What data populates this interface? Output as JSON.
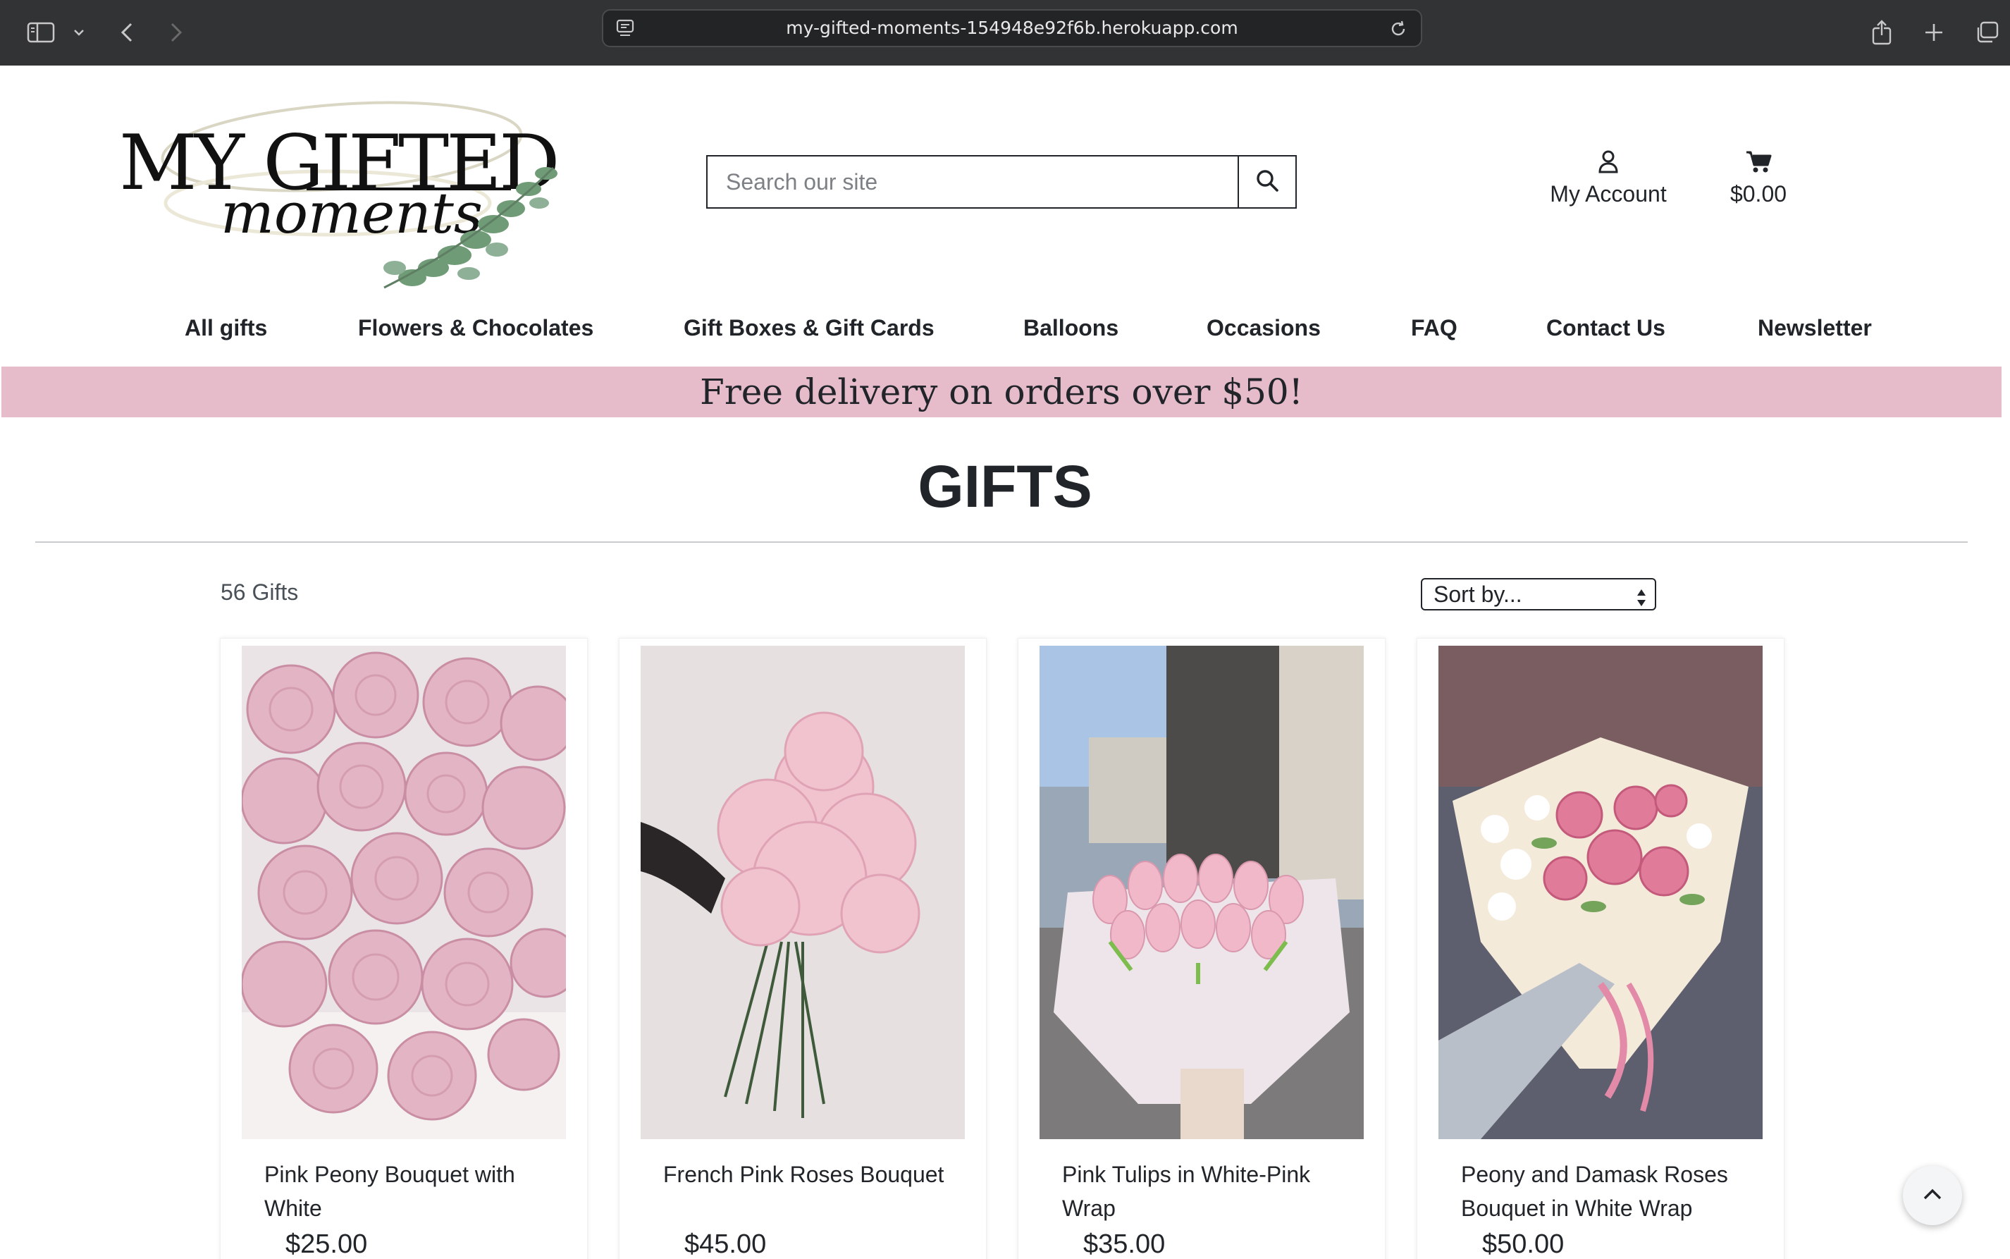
{
  "browser": {
    "url": "my-gifted-moments-154948e92f6b.herokuapp.com"
  },
  "header": {
    "logo_text": "MY GIFTED moments",
    "search_placeholder": "Search our site",
    "account_label": "My Account",
    "cart_total": "$0.00"
  },
  "nav": {
    "items": [
      {
        "label": "All gifts"
      },
      {
        "label": "Flowers & Chocolates"
      },
      {
        "label": "Gift Boxes & Gift Cards"
      },
      {
        "label": "Balloons"
      },
      {
        "label": "Occasions"
      },
      {
        "label": "FAQ"
      },
      {
        "label": "Contact Us"
      },
      {
        "label": "Newsletter"
      }
    ]
  },
  "banner": {
    "text": "Free delivery on orders over $50!"
  },
  "main": {
    "title": "GIFTS",
    "count_label": "56 Gifts",
    "sort_label": "Sort by..."
  },
  "products": [
    {
      "name": "Pink Peony Bouquet with White",
      "price": "$25.00"
    },
    {
      "name": "French Pink Roses Bouquet",
      "price": "$45.00"
    },
    {
      "name": "Pink Tulips in White-Pink Wrap",
      "price": "$35.00"
    },
    {
      "name": "Peony and Damask Roses Bouquet in White Wrap",
      "price": "$50.00"
    }
  ],
  "colors": {
    "banner_bg": "#e6bccb",
    "chrome_bg": "#323335",
    "text": "#212529"
  },
  "icons": [
    "sidebar-icon",
    "chevron-down-icon",
    "back-icon",
    "forward-icon",
    "tab-icon",
    "reload-icon",
    "share-icon",
    "new-tab-icon",
    "tabs-overview-icon",
    "search-icon",
    "user-icon",
    "cart-icon",
    "chevron-up-icon"
  ]
}
